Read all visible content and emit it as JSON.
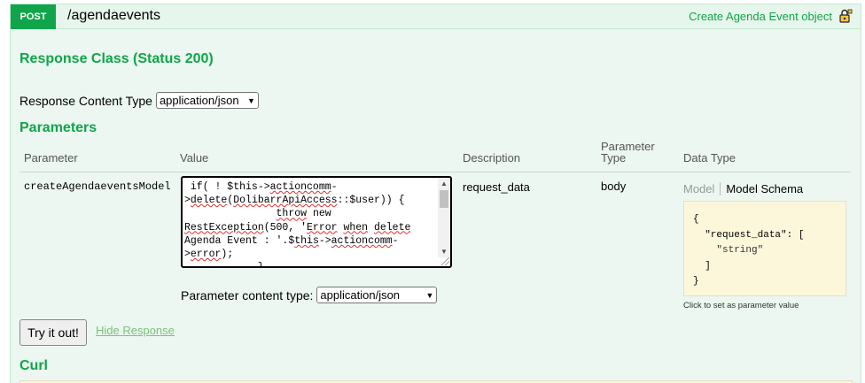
{
  "operation": {
    "method": "POST",
    "path": "/agendaevents",
    "summary": "Create Agenda Event object",
    "lock_icon": "lock-icon"
  },
  "response": {
    "class_title": "Response Class (Status 200)",
    "content_type_label": "Response Content Type",
    "content_type_value": "application/json"
  },
  "parameters": {
    "title": "Parameters",
    "headers": {
      "parameter": "Parameter",
      "value": "Value",
      "description": "Description",
      "type": "Parameter Type",
      "data_type": "Data Type"
    },
    "row": {
      "name": "createAgendaeventsModel",
      "description": "request_data",
      "param_type": "body",
      "content_type_label": "Parameter content type:",
      "content_type_value": "application/json"
    },
    "model_tab": "Model",
    "schema_tab": "Model Schema",
    "hint": "Click to set as parameter value"
  },
  "actions": {
    "try_label": "Try it out!",
    "hide_label": "Hide Response"
  },
  "curl": {
    "title": "Curl"
  },
  "colors": {
    "accent": "#10a54a",
    "op_background": "#ebf7f0",
    "schema_background": "#fcf6db"
  }
}
